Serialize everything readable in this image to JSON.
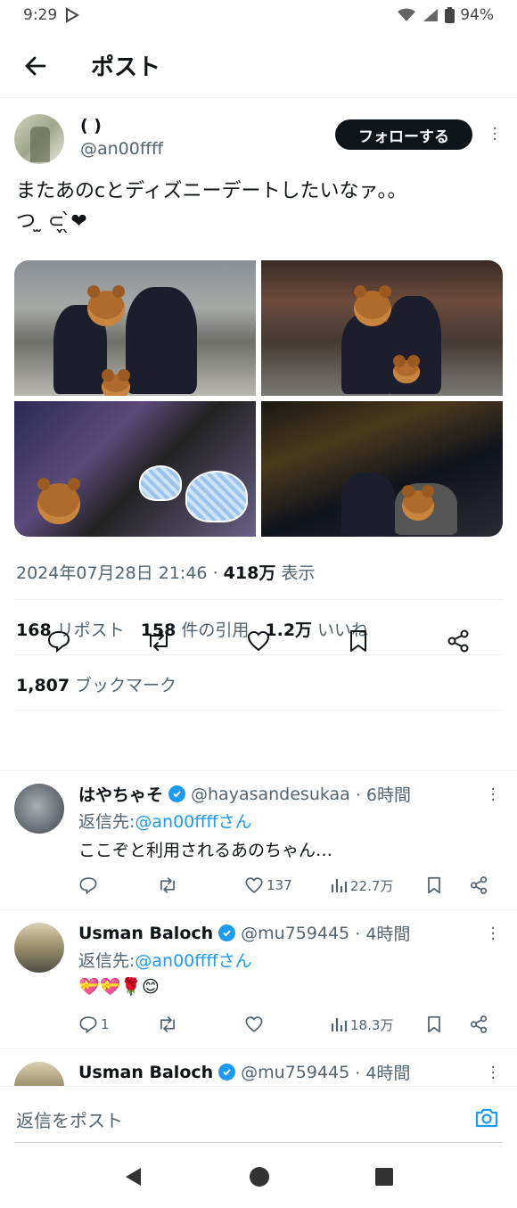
{
  "status": {
    "time": "9:29",
    "battery": "94%"
  },
  "header": {
    "title": "ポスト"
  },
  "post": {
    "author_name": "( )",
    "author_handle": "@an00ffff",
    "follow_label": "フォローする",
    "text_line1": "またあのcとディズニーデートしたいなァ。。",
    "text_line2": "つ ̫ ⊂̖̗ ̖̀❤",
    "date": "2024年07月28日 21:46",
    "views_value": "418万",
    "views_label": "表示",
    "reposts_value": "168",
    "reposts_label": "リポスト",
    "quotes_value": "158",
    "quotes_label": "件の引用",
    "likes_value": "1.2万",
    "likes_label": "いいね",
    "bookmarks_value": "1,807",
    "bookmarks_label": "ブックマーク"
  },
  "replies": [
    {
      "name": "はやちゃそ",
      "handle": "@hayasandesukaa",
      "time": "· 6時間",
      "reply_to_prefix": "返信先:",
      "reply_to": "@an00ffffさん",
      "text": "ここぞと利用されるあのちゃん…",
      "replies_count": "",
      "likes": "137",
      "views": "22.7万"
    },
    {
      "name": "Usman Baloch",
      "handle": "@mu759445",
      "time": "· 4時間",
      "reply_to_prefix": "返信先:",
      "reply_to": "@an00ffffさん",
      "text": "💝💝🌹😊",
      "replies_count": "1",
      "likes": "",
      "views": "18.3万"
    },
    {
      "name": "Usman Baloch",
      "handle": "@mu759445",
      "time": "· 4時間"
    }
  ],
  "composer": {
    "placeholder": "返信をポスト"
  },
  "colors": {
    "accent": "#1d9bf0",
    "text": "#0f1419",
    "muted": "#536471"
  }
}
